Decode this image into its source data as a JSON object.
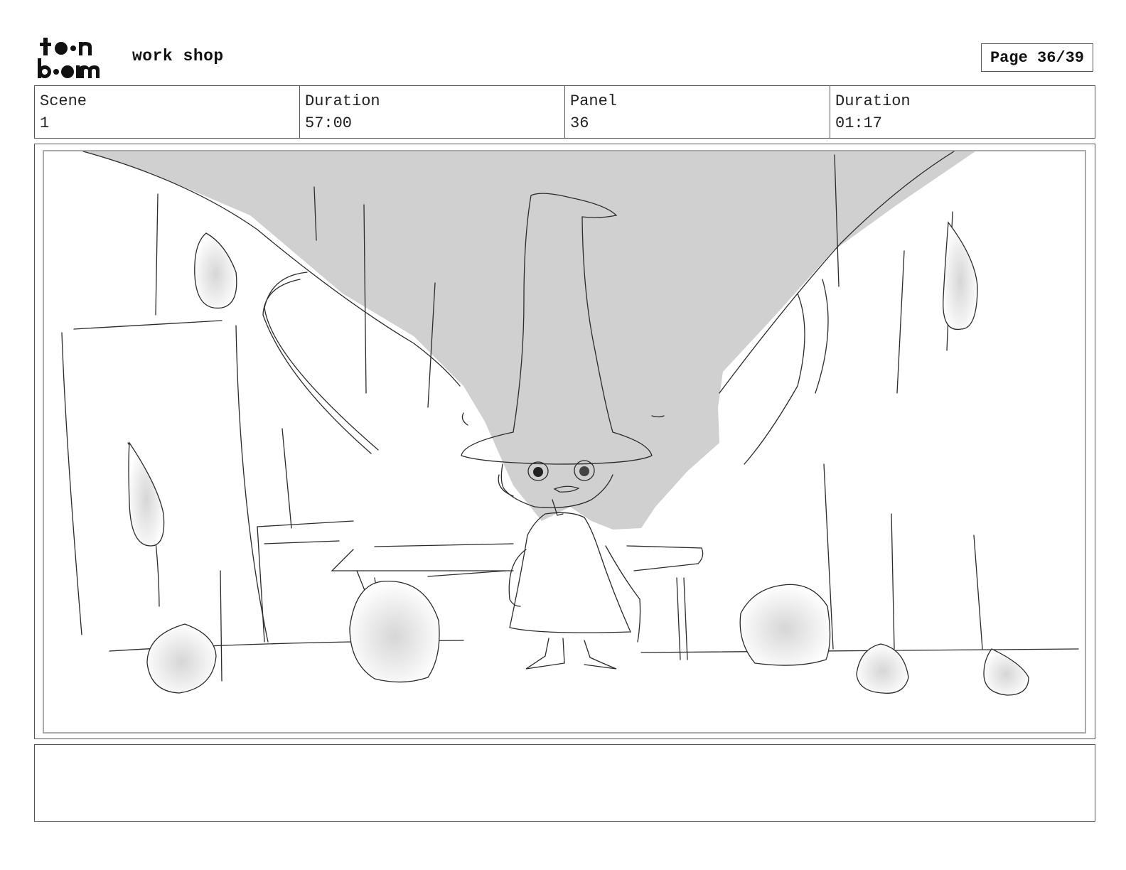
{
  "header": {
    "logo_text_top": "toon",
    "logo_text_bottom": "boom",
    "title": "work shop",
    "page_label": "Page 36/39"
  },
  "info": {
    "scene_label": "Scene",
    "scene_value": "1",
    "scene_duration_label": "Duration",
    "scene_duration_value": "57:00",
    "panel_label": "Panel",
    "panel_value": "36",
    "panel_duration_label": "Duration",
    "panel_duration_value": "01:17"
  },
  "notes": {
    "text": ""
  }
}
